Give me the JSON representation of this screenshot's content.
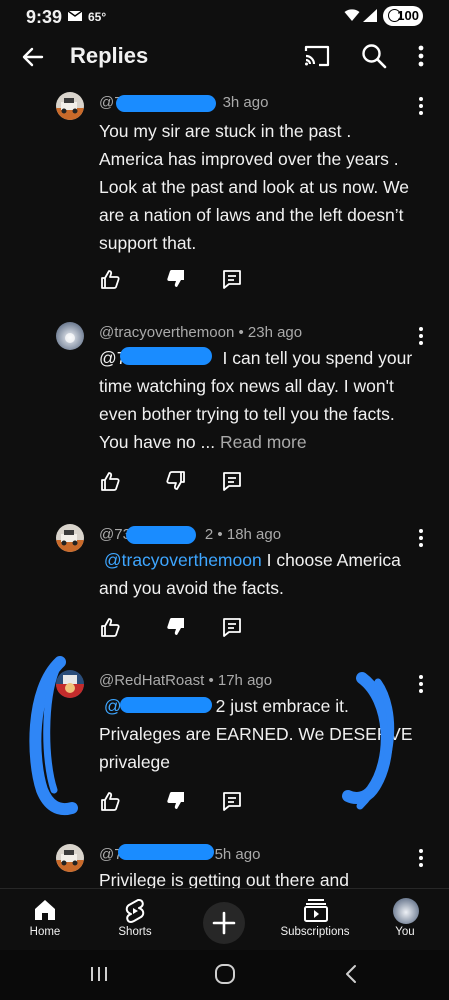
{
  "status_bar": {
    "time": "9:39",
    "temperature": "65°",
    "battery": "100"
  },
  "header": {
    "title": "Replies"
  },
  "comments": [
    {
      "handle": "@7",
      "time": "3h ago",
      "text": "You my sir are stuck in the past . America has improved over the years . Look at the past and look at us now. We are a nation of laws and the left doesn’t support that.",
      "disliked": true
    },
    {
      "handle": "@tracyoverthemoon",
      "time": "23h ago",
      "mention": "@7",
      "text": "I can tell you spend your time watching fox news all day. I won't even bother trying to tell you the facts. You have no ...",
      "read_more": "Read more",
      "disliked": false
    },
    {
      "handle": "@73",
      "time": "2 • 18h ago",
      "mention": "@tracyoverthemoon",
      "text": "I choose America and you avoid the facts.",
      "disliked": true
    },
    {
      "handle": "@RedHatRoast",
      "time": "17h ago",
      "mention": "@",
      "text_after_mention": "2 just embrace it.",
      "text": "Privaleges are EARNED. We DESERVE privalege",
      "disliked": true
    },
    {
      "handle": "@7",
      "time": "5h ago",
      "text": "Privilege is getting out there and"
    }
  ],
  "bottom_nav": {
    "items": [
      {
        "label": "Home",
        "icon": "home-icon"
      },
      {
        "label": "Shorts",
        "icon": "shorts-icon"
      },
      {
        "label": "",
        "icon": "create-icon"
      },
      {
        "label": "Subscriptions",
        "icon": "subscriptions-icon"
      },
      {
        "label": "You",
        "icon": "avatar"
      }
    ]
  },
  "colors": {
    "background": "#0f0f0f",
    "link": "#3ea6ff",
    "scribble": "#2f86f6"
  }
}
